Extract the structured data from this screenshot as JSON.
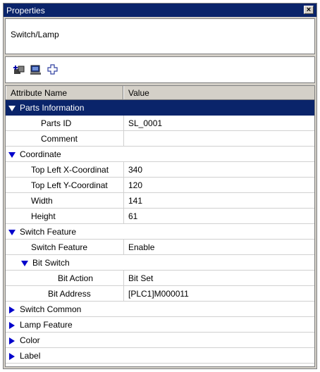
{
  "window": {
    "title": "Properties",
    "close_glyph": "×"
  },
  "object_type": "Switch/Lamp",
  "toolbar": {
    "icons": [
      "add-parts-icon",
      "display-icon",
      "plus-icon"
    ]
  },
  "grid": {
    "headers": {
      "name": "Attribute Name",
      "value": "Value"
    },
    "rows": [
      {
        "name": "Parts Information",
        "group": true,
        "expanded": true,
        "level": 0,
        "selected": true
      },
      {
        "name": "Parts ID",
        "value": "SL_0001",
        "level": 1
      },
      {
        "name": "Comment",
        "value": "",
        "level": 1
      },
      {
        "name": "Coordinate",
        "group": true,
        "expanded": true,
        "level": 0
      },
      {
        "name": "Top Left X-Coordinat",
        "value": "340",
        "level": 1
      },
      {
        "name": "Top Left Y-Coordinat",
        "value": "120",
        "level": 1
      },
      {
        "name": "Width",
        "value": "141",
        "level": 1
      },
      {
        "name": "Height",
        "value": "61",
        "level": 1
      },
      {
        "name": "Switch Feature",
        "group": true,
        "expanded": true,
        "level": 0
      },
      {
        "name": "Switch Feature",
        "value": "Enable",
        "level": 1
      },
      {
        "name": "Bit Switch",
        "group": true,
        "expanded": true,
        "level": 1
      },
      {
        "name": "Bit Action",
        "value": "Bit Set",
        "level": 2
      },
      {
        "name": "Bit Address",
        "value": "[PLC1]M000011",
        "level": 2
      },
      {
        "name": "Switch Common",
        "group": true,
        "expanded": false,
        "level": 0
      },
      {
        "name": "Lamp Feature",
        "group": true,
        "expanded": false,
        "level": 0
      },
      {
        "name": "Color",
        "group": true,
        "expanded": false,
        "level": 0
      },
      {
        "name": "Label",
        "group": true,
        "expanded": false,
        "level": 0
      }
    ]
  },
  "colors": {
    "titlebar": "#0a246a",
    "selection": "#0a246a",
    "tree_arrow": "#0000cc",
    "chrome": "#d4d0c8"
  }
}
